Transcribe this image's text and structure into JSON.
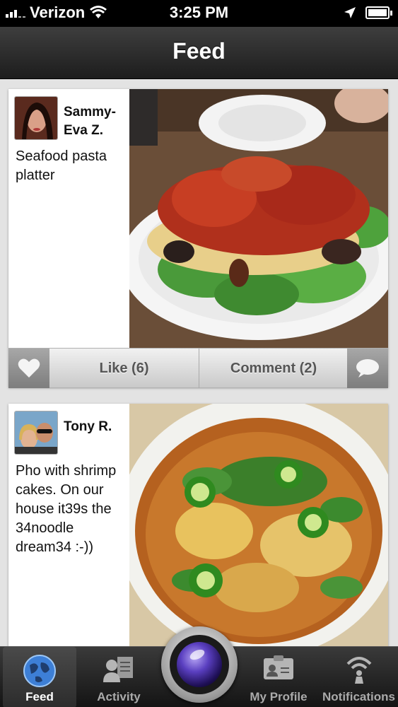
{
  "status_bar": {
    "carrier": "Verizon",
    "time": "3:25 PM",
    "icons": [
      "signal-icon",
      "wifi-icon",
      "location-arrow-icon",
      "battery-charging-icon"
    ]
  },
  "nav": {
    "title": "Feed"
  },
  "posts": [
    {
      "username": "Sammy-Eva Z.",
      "caption": "Seafood pasta platter",
      "like_label": "Like (6)",
      "comment_label": "Comment (2)"
    },
    {
      "username": "Tony R.",
      "caption": "Pho with shrimp cakes. On our house it39s the 34noodle dream34  :-))"
    }
  ],
  "tab_bar": {
    "tabs": [
      {
        "label": "Feed",
        "icon": "globe-icon",
        "active": true
      },
      {
        "label": "Activity",
        "icon": "activity-icon",
        "active": false
      },
      {
        "label": "My Profile",
        "icon": "profile-card-icon",
        "active": false
      },
      {
        "label": "Notifications",
        "icon": "notifications-icon",
        "active": false
      }
    ],
    "camera_icon": "camera-lens-icon"
  },
  "colors": {
    "accent_blue": "#3d7fd6",
    "nav_dark": "#2a2a2a"
  }
}
